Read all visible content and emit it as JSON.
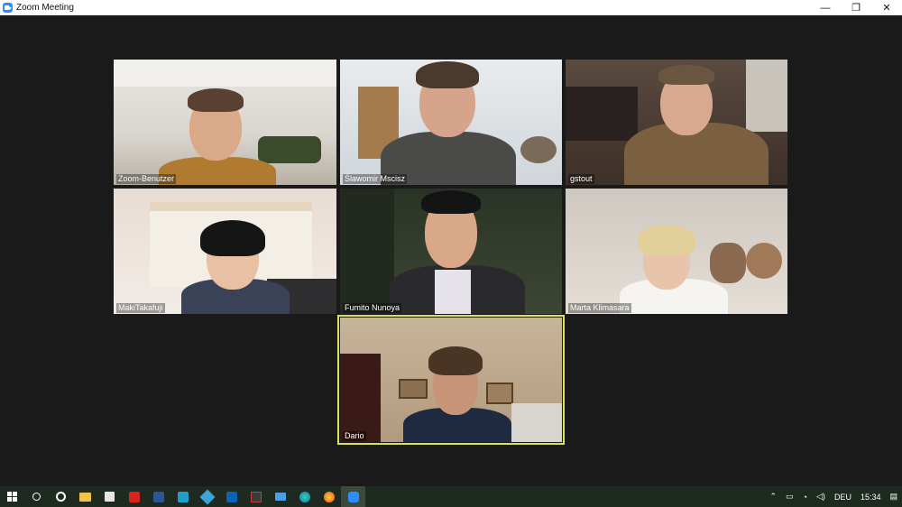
{
  "window": {
    "title": "Zoom Meeting",
    "minimize_glyph": "—",
    "restore_glyph": "❐",
    "close_glyph": "✕"
  },
  "participants": [
    {
      "name": "Zoom-Benutzer"
    },
    {
      "name": "Ślawomir Mscisz"
    },
    {
      "name": "gstout"
    },
    {
      "name": "MakiTakafuji"
    },
    {
      "name": "Fumito Nunoya"
    },
    {
      "name": "Marta Klimasara"
    },
    {
      "name": "Dario"
    }
  ],
  "active_speaker": "Dario",
  "taskbar": {
    "apps": [
      "windows-start-icon",
      "search-icon",
      "cortana-icon",
      "file-explorer-icon",
      "store-icon",
      "acrobat-icon",
      "word-icon",
      "app-icon",
      "app2-icon",
      "outlook-icon",
      "app3-icon",
      "mail-icon",
      "edge-icon",
      "firefox-icon",
      "zoom-icon"
    ],
    "language": "DEU",
    "time": "15:34"
  },
  "colors": {
    "accent": "#2d8cff",
    "active_border": "#d8e25a",
    "taskbar": "#1e2a20"
  }
}
